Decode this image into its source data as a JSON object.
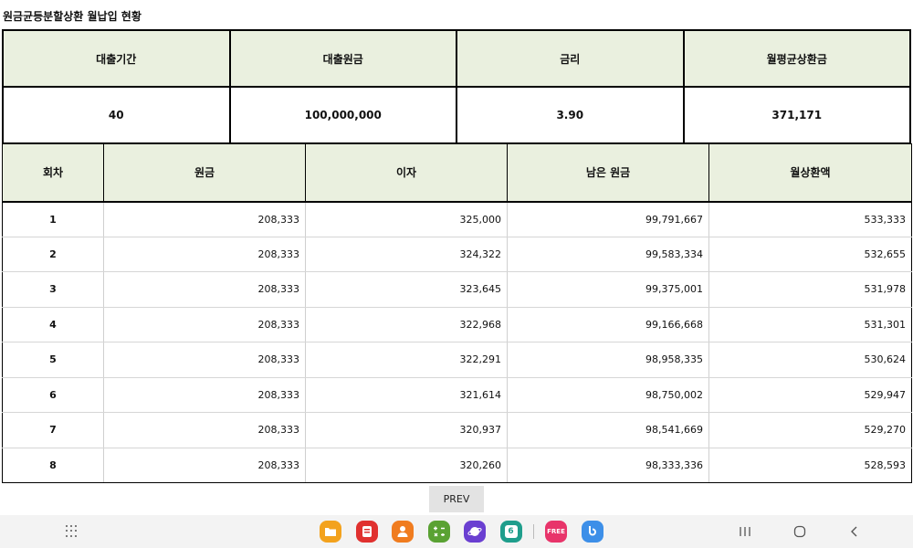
{
  "title": "원금균등분할상환 월납입 현황",
  "summary": {
    "headers": [
      "대출기간",
      "대출원금",
      "금리",
      "월평균상환금"
    ],
    "values": [
      "40",
      "100,000,000",
      "3.90",
      "371,171"
    ]
  },
  "schedule": {
    "headers": [
      "회차",
      "원금",
      "이자",
      "남은 원금",
      "월상환액"
    ],
    "rows": [
      [
        "1",
        "208,333",
        "325,000",
        "99,791,667",
        "533,333"
      ],
      [
        "2",
        "208,333",
        "324,322",
        "99,583,334",
        "532,655"
      ],
      [
        "3",
        "208,333",
        "323,645",
        "99,375,001",
        "531,978"
      ],
      [
        "4",
        "208,333",
        "322,968",
        "99,166,668",
        "531,301"
      ],
      [
        "5",
        "208,333",
        "322,291",
        "98,958,335",
        "530,624"
      ],
      [
        "6",
        "208,333",
        "321,614",
        "98,750,002",
        "529,947"
      ],
      [
        "7",
        "208,333",
        "320,937",
        "98,541,669",
        "529,270"
      ],
      [
        "8",
        "208,333",
        "320,260",
        "98,333,336",
        "528,593"
      ]
    ]
  },
  "prev_label": "PREV",
  "taskbar": {
    "apps": [
      {
        "icon": "folder-icon",
        "color": "#f3a21d"
      },
      {
        "icon": "notes-icon",
        "color": "#e0312f"
      },
      {
        "icon": "contacts-icon",
        "color": "#f07c1f"
      },
      {
        "icon": "calculator-icon",
        "color": "#5aa233"
      },
      {
        "icon": "internet-icon",
        "color": "#6a3fd1"
      },
      {
        "icon": "calendar-icon",
        "color": "#1f9e8c"
      },
      {
        "icon": "free-icon",
        "color": "#e8346a"
      },
      {
        "icon": "bixby-icon",
        "color": "#3d8fe8"
      }
    ],
    "calendar_day": "6",
    "free_label": "FREE"
  }
}
